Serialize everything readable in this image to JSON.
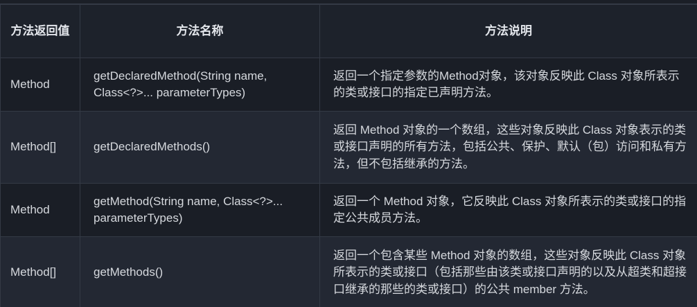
{
  "table": {
    "headers": [
      "方法返回值",
      "方法名称",
      "方法说明"
    ],
    "rows": [
      {
        "return_type": "Method",
        "method": "getDeclaredMethod(String name, Class<?>... parameterTypes)",
        "description": "返回一个指定参数的Method对象，该对象反映此 Class 对象所表示的类或接口的指定已声明方法。"
      },
      {
        "return_type": "Method[]",
        "method": "getDeclaredMethods()",
        "description": "返回 Method 对象的一个数组，这些对象反映此 Class 对象表示的类或接口声明的所有方法，包括公共、保护、默认（包）访问和私有方法，但不包括继承的方法。"
      },
      {
        "return_type": "Method",
        "method": "getMethod(String name, Class<?>... parameterTypes)",
        "description": "返回一个 Method 对象，它反映此 Class 对象所表示的类或接口的指定公共成员方法。"
      },
      {
        "return_type": "Method[]",
        "method": "getMethods()",
        "description": "返回一个包含某些 Method 对象的数组，这些对象反映此 Class 对象所表示的类或接口（包括那些由该类或接口声明的以及从超类和超接口继承的那些的类或接口）的公共 member 方法。"
      }
    ]
  }
}
